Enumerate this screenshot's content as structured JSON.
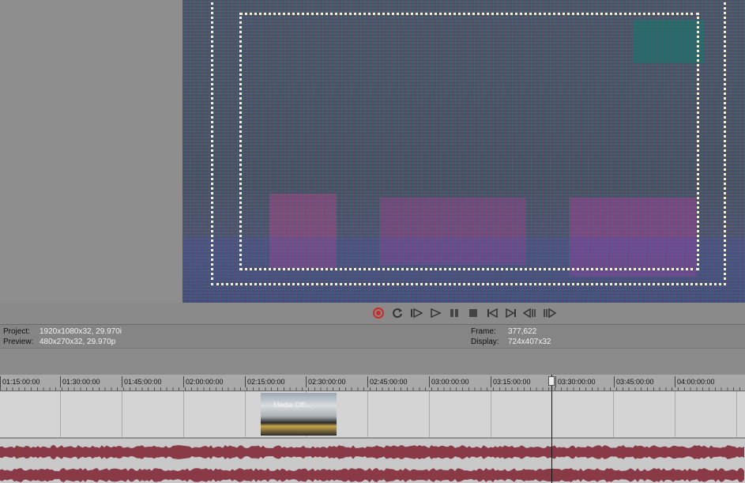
{
  "transport": {
    "buttons": [
      {
        "name": "record-button",
        "icon": "record-icon"
      },
      {
        "name": "loop-button",
        "icon": "loop-icon"
      },
      {
        "name": "play-from-start-button",
        "icon": "play-from-start-icon"
      },
      {
        "name": "play-button",
        "icon": "play-icon"
      },
      {
        "name": "pause-button",
        "icon": "pause-icon"
      },
      {
        "name": "stop-button",
        "icon": "stop-icon"
      },
      {
        "name": "go-to-start-button",
        "icon": "go-to-start-icon"
      },
      {
        "name": "go-to-end-button",
        "icon": "go-to-end-icon"
      },
      {
        "name": "previous-frame-button",
        "icon": "previous-frame-icon"
      },
      {
        "name": "next-frame-button",
        "icon": "next-frame-icon"
      }
    ]
  },
  "info": {
    "project_label": "Project:",
    "project_value": "1920x1080x32, 29.970i",
    "preview_label": "Preview:",
    "preview_value": "480x270x32, 29.970p",
    "frame_label": "Frame:",
    "frame_value": "377,622",
    "display_label": "Display:",
    "display_value": "724x407x32"
  },
  "timeline": {
    "ticks": [
      "01:15:00:00",
      "01:30:00:00",
      "01:45:00:00",
      "02:00:00:00",
      "02:15:00:00",
      "02:30:00:00",
      "02:45:00:00",
      "03:00:00:00",
      "03:15:00:00",
      "03:30:00:00",
      "03:45:00:00",
      "04:00:00:00"
    ],
    "clip_label": "Media Offl..."
  },
  "colors": {
    "audio_waveform": "#8a3a46",
    "record_icon": "#cc2b2b",
    "safe_area": "#f3f3d8"
  }
}
